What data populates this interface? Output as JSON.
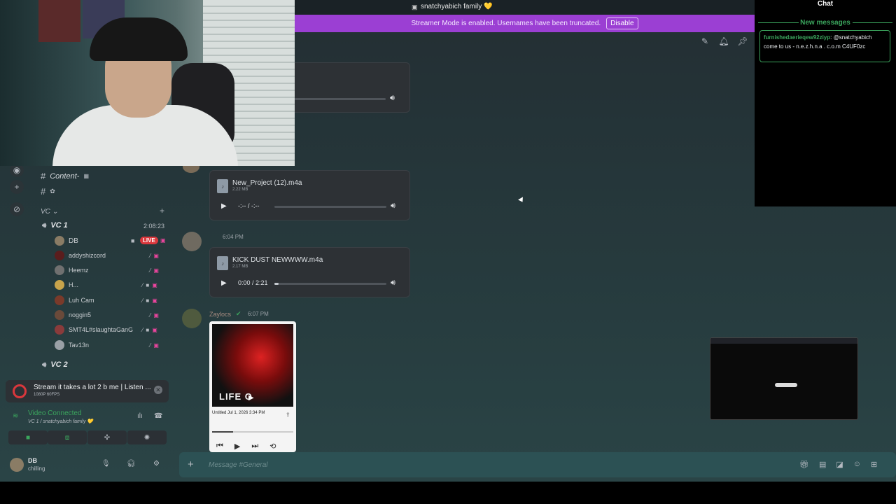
{
  "header": {
    "server_title": "snatchyabich family 💛",
    "streamer_notice": "Streamer Mode is enabled. Usernames have been truncated.",
    "disable_label": "Disable",
    "icons": [
      "threads-icon",
      "bell-icon",
      "pin-icon"
    ]
  },
  "sidebar": {
    "channels": [
      {
        "name": "Content-",
        "icon": "hash-icon"
      },
      {
        "name": "",
        "icon": "hash-icon"
      }
    ],
    "vc_category": "VC",
    "vc1": {
      "name": "VC 1",
      "timer": "2:08:23",
      "members": [
        {
          "name": "DB",
          "live": true,
          "live_label": "LIVE"
        },
        {
          "name": "addyshizcord"
        },
        {
          "name": "Heemz"
        },
        {
          "name": "H..."
        },
        {
          "name": "Luh Cam"
        },
        {
          "name": "noggin5"
        },
        {
          "name": "SMT4L#slaughtaGanG"
        },
        {
          "name": "Tav13n"
        }
      ]
    },
    "vc2": {
      "name": "VC 2"
    }
  },
  "stream_card": {
    "title": "Stream it takes a lot 2 b me | Listen ...",
    "quality": "1080P 60FPS"
  },
  "voice_panel": {
    "status": "Video Connected",
    "location": "VC 1 / snatchyabich family 💛"
  },
  "user": {
    "name": "DB",
    "status": "chilling"
  },
  "messages": [
    {
      "file": "New_Project (12).m4a",
      "size": "2.22 MB",
      "time": "-:-- / -:--",
      "progress": 0
    },
    {
      "timestamp": "6:04 PM",
      "file": "KICK DUST NEWWWW.m4a",
      "size": "2.17 MB",
      "time": "0:00 / 2:21",
      "progress": 0
    },
    {
      "author": "Zaylocs",
      "timestamp": "6:07 PM",
      "video_caption": "Untitled Jul 1, 2026 3:34 PM",
      "video_art_title": "LIFE O"
    }
  ],
  "composer": {
    "placeholder": "Message #General"
  },
  "chat_overlay": {
    "title": "Chat",
    "new_messages": "New messages",
    "message": {
      "author": "furnishedaerieqew92ziyp",
      "text": "@snatchyabich come to us - n.e.z.h.n.a . c.o.m C4UF0zc"
    }
  }
}
